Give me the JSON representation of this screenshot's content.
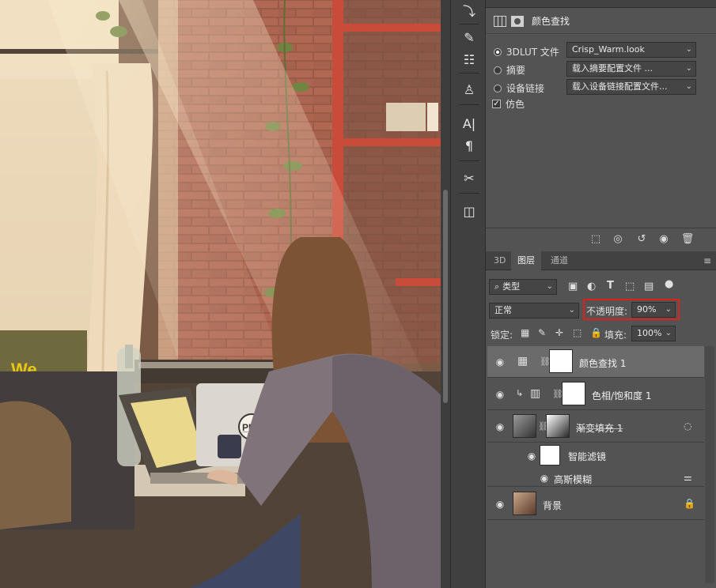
{
  "properties": {
    "title": "颜色查找",
    "lut_label": "3DLUT 文件",
    "lut_value": "Crisp_Warm.look",
    "abstract_label": "摘要",
    "abstract_value": "载入摘要配置文件 ...",
    "device_label": "设备链接",
    "device_value": "载入设备链接配置文件...",
    "dither_label": "仿色"
  },
  "layers_panel": {
    "tabs": [
      "3D",
      "图层",
      "通道"
    ],
    "filter_label": "类型",
    "blend_mode": "正常",
    "opacity_label": "不透明度:",
    "opacity_value": "90%",
    "lock_label": "锁定:",
    "fill_label": "填充:",
    "fill_value": "100%",
    "layers": [
      {
        "name": "颜色查找 1"
      },
      {
        "name": "色相/饱和度 1"
      },
      {
        "name": "渐变填充 1"
      },
      {
        "name": "智能滤镜"
      },
      {
        "name": "高斯模糊"
      },
      {
        "name": "背景"
      }
    ]
  },
  "canvas": {
    "sign_text": "We",
    "sticker_text": "P̲L"
  },
  "colors": {
    "accent_highlight": "#e0201a",
    "panel_bg": "#535353",
    "selected_row": "#6b6b6b"
  }
}
